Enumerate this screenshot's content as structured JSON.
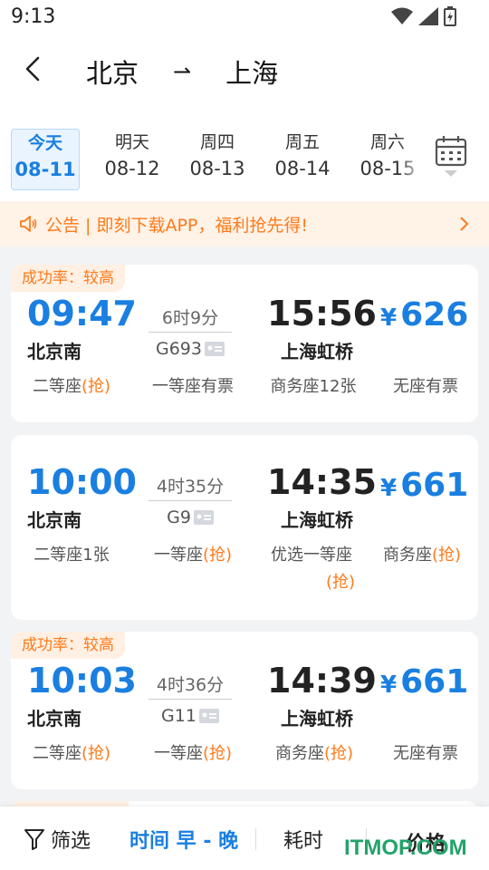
{
  "status_bar": {
    "time": "9:13"
  },
  "header": {
    "from": "北京",
    "to": "上海",
    "arrow": "⇀"
  },
  "dates": [
    {
      "weekday": "今天",
      "date": "08-11",
      "active": true
    },
    {
      "weekday": "明天",
      "date": "08-12"
    },
    {
      "weekday": "周四",
      "date": "08-13"
    },
    {
      "weekday": "周五",
      "date": "08-14"
    },
    {
      "weekday": "周六",
      "date": "08-15"
    }
  ],
  "notice": {
    "text": "公告 | 即刻下载APP，福利抢先得!"
  },
  "trains": [
    {
      "rate": "成功率：较高",
      "dep_time": "09:47",
      "dep_station": "北京南",
      "duration": "6时9分",
      "train_no": "G693",
      "arr_time": "15:56",
      "arr_station": "上海虹桥",
      "price_symbol": "¥",
      "price": "626",
      "seats": [
        {
          "name": "二等座",
          "status": "(抢)"
        },
        {
          "name": "一等座有票",
          "status": ""
        },
        {
          "name": "商务座12张",
          "status": ""
        },
        {
          "name": "无座有票",
          "status": ""
        }
      ]
    },
    {
      "rate": "",
      "dep_time": "10:00",
      "dep_station": "北京南",
      "duration": "4时35分",
      "train_no": "G9",
      "arr_time": "14:35",
      "arr_station": "上海虹桥",
      "price_symbol": "¥",
      "price": "661",
      "seats": [
        {
          "name": "二等座1张",
          "status": ""
        },
        {
          "name": "一等座",
          "status": "(抢)"
        },
        {
          "name": "优选一等座",
          "status": "(抢)"
        },
        {
          "name": "商务座",
          "status": "(抢)"
        }
      ]
    },
    {
      "rate": "成功率：较高",
      "dep_time": "10:03",
      "dep_station": "北京南",
      "duration": "4时36分",
      "train_no": "G11",
      "arr_time": "14:39",
      "arr_station": "上海虹桥",
      "price_symbol": "¥",
      "price": "661",
      "seats": [
        {
          "name": "二等座",
          "status": "(抢)"
        },
        {
          "name": "一等座",
          "status": "(抢)"
        },
        {
          "name": "商务座",
          "status": "(抢)"
        },
        {
          "name": "无座有票",
          "status": ""
        }
      ]
    }
  ],
  "bottom_bar": {
    "filter": "筛选",
    "time_sort": "时间 早 - 晚",
    "duration_sort": "耗时",
    "price_sort": "价格"
  },
  "watermark": "ITMOP.COM",
  "colors": {
    "accent": "#1a7fe0",
    "warning": "#ff7a1a"
  }
}
